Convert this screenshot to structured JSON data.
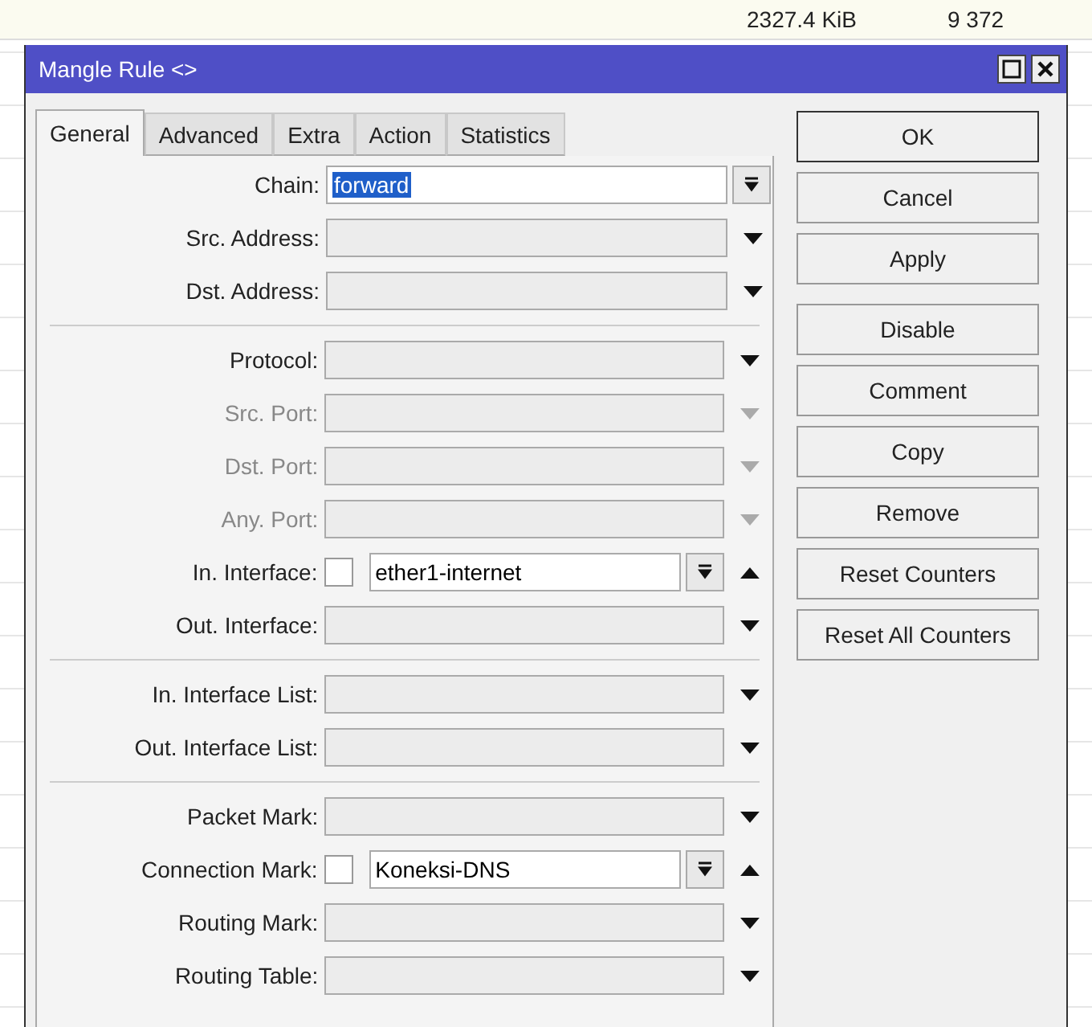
{
  "background_window": {
    "cells": [
      "2327.4 KiB",
      "9 372"
    ]
  },
  "window": {
    "title": "Mangle Rule <>"
  },
  "tabs": [
    {
      "label": "General",
      "selected": true
    },
    {
      "label": "Advanced",
      "selected": false
    },
    {
      "label": "Extra",
      "selected": false
    },
    {
      "label": "Action",
      "selected": false
    },
    {
      "label": "Statistics",
      "selected": false
    }
  ],
  "field_groups": [
    [
      {
        "label": "Chain:",
        "kind": "combo",
        "value": "forward",
        "value_selected": true,
        "disabled": false
      },
      {
        "label": "Src. Address:",
        "kind": "dropdown",
        "disabled": false
      },
      {
        "label": "Dst. Address:",
        "kind": "dropdown",
        "disabled": false
      }
    ],
    [
      {
        "label": "Protocol:",
        "kind": "dropdown",
        "disabled": false
      },
      {
        "label": "Src. Port:",
        "kind": "dropdown",
        "disabled": true
      },
      {
        "label": "Dst. Port:",
        "kind": "dropdown",
        "disabled": true
      },
      {
        "label": "Any. Port:",
        "kind": "dropdown",
        "disabled": true
      },
      {
        "label": "In. Interface:",
        "kind": "negatable",
        "value": "ether1-internet",
        "checked": false,
        "disabled": false
      },
      {
        "label": "Out. Interface:",
        "kind": "dropdown",
        "disabled": false
      }
    ],
    [
      {
        "label": "In. Interface List:",
        "kind": "dropdown",
        "disabled": false
      },
      {
        "label": "Out. Interface List:",
        "kind": "dropdown",
        "disabled": false
      }
    ],
    [
      {
        "label": "Packet Mark:",
        "kind": "dropdown",
        "disabled": false
      },
      {
        "label": "Connection Mark:",
        "kind": "negatable",
        "value": "Koneksi-DNS",
        "checked": false,
        "disabled": false
      },
      {
        "label": "Routing Mark:",
        "kind": "dropdown",
        "disabled": false
      },
      {
        "label": "Routing Table:",
        "kind": "dropdown",
        "disabled": false
      }
    ]
  ],
  "buttons": [
    [
      "OK",
      "Cancel",
      "Apply"
    ],
    [
      "Disable",
      "Comment",
      "Copy",
      "Remove",
      "Reset Counters",
      "Reset All Counters"
    ]
  ]
}
